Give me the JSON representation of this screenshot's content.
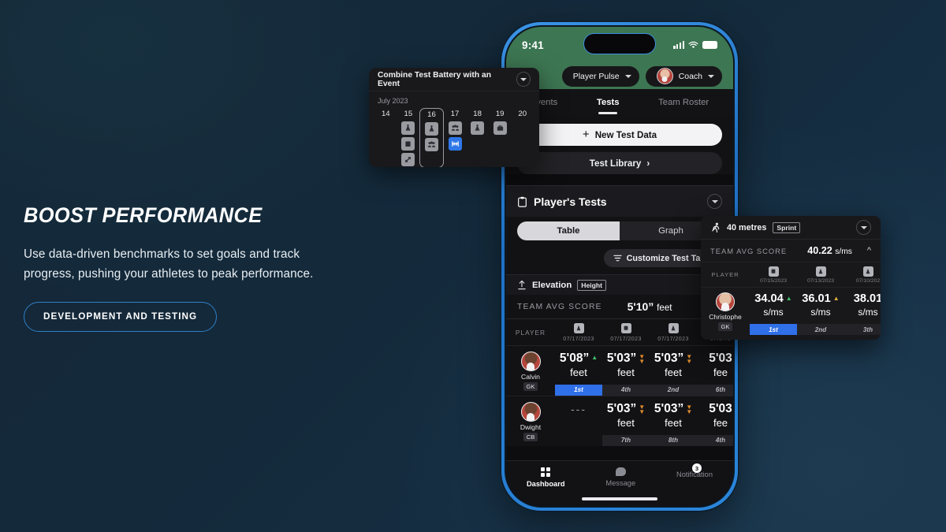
{
  "hero": {
    "title": "BOOST PERFORMANCE",
    "body": "Use data-driven benchmarks to set goals and track progress, pushing your athletes to peak performance.",
    "cta": "DEVELOPMENT AND TESTING",
    "accent": "#2f7fc4"
  },
  "phone": {
    "status": {
      "time": "9:41"
    },
    "header": {
      "mode_select": "Player Pulse",
      "role_select": "Coach"
    },
    "tabs": [
      {
        "label": "Events",
        "active": false
      },
      {
        "label": "Tests",
        "active": true
      },
      {
        "label": "Team Roster",
        "active": false
      }
    ],
    "actions": {
      "new_test": "New Test Data",
      "new_test_plus": "+",
      "test_library": "Test Library",
      "test_library_chevron": "›"
    },
    "players_tests": {
      "title": "Player's Tests",
      "segments": [
        {
          "label": "Table",
          "active": true
        },
        {
          "label": "Graph",
          "active": false
        }
      ],
      "customize": "Customize Test Table"
    },
    "metric": {
      "name": "Elevation",
      "tag": "Height",
      "avg_label": "TEAM AVG SCORE",
      "avg_value": "5'10”",
      "avg_unit": "feet",
      "collapse_caret": "⌃"
    },
    "table": {
      "player_col": "PLAYER",
      "columns": [
        {
          "date": "07/17/2023",
          "icon": "cone-icon"
        },
        {
          "date": "07/17/2023",
          "icon": "clipboard-icon"
        },
        {
          "date": "07/17/2023",
          "icon": "cone-icon"
        },
        {
          "date": "07/17/2",
          "icon": "cone-icon"
        }
      ],
      "rows": [
        {
          "name": "Calvin",
          "position": "GK",
          "cells": [
            {
              "value": "5'08”",
              "unit": "feet",
              "trend": "up",
              "rank": "1st",
              "first": true
            },
            {
              "value": "5'03”",
              "unit": "feet",
              "trend": "down",
              "rank": "4th",
              "first": false
            },
            {
              "value": "5'03”",
              "unit": "feet",
              "trend": "down",
              "rank": "2nd",
              "first": false
            },
            {
              "value": "5'03",
              "unit": "fee",
              "trend": "down",
              "rank": "6th",
              "first": false
            }
          ]
        },
        {
          "name": "Dwight",
          "position": "CB",
          "cells": [
            {
              "value": "---",
              "unit": "",
              "trend": "none",
              "rank": "",
              "first": false
            },
            {
              "value": "5'03”",
              "unit": "feet",
              "trend": "down",
              "rank": "7th",
              "first": false
            },
            {
              "value": "5'03”",
              "unit": "feet",
              "trend": "down",
              "rank": "8th",
              "first": false
            },
            {
              "value": "5'03",
              "unit": "fee",
              "trend": "down",
              "rank": "4th",
              "first": false
            }
          ]
        }
      ]
    },
    "bottom_nav": [
      {
        "label": "Dashboard",
        "icon": "grid-icon",
        "active": true,
        "badge": ""
      },
      {
        "label": "Message",
        "icon": "chat-bubble-icon",
        "active": false,
        "badge": ""
      },
      {
        "label": "Notification",
        "icon": "bell-icon",
        "active": false,
        "badge": "3"
      }
    ]
  },
  "calendar_popup": {
    "title": "Combine Test Battery with an Event",
    "month": "July 2023",
    "days": [
      {
        "num": "14",
        "selected": false,
        "events": []
      },
      {
        "num": "15",
        "selected": false,
        "events": [
          "cone-icon",
          "clipboard-icon",
          "expand-icon"
        ]
      },
      {
        "num": "16",
        "selected": true,
        "events": [
          "cone-icon",
          "group-icon"
        ]
      },
      {
        "num": "17",
        "selected": false,
        "events": [
          "group-icon",
          "match-icon"
        ]
      },
      {
        "num": "18",
        "selected": false,
        "events": [
          "cone-icon"
        ]
      },
      {
        "num": "19",
        "selected": false,
        "events": [
          "briefcase-icon"
        ]
      },
      {
        "num": "20",
        "selected": false,
        "events": []
      }
    ]
  },
  "sprint_popup": {
    "title": "40 metres",
    "tag": "Sprint",
    "avg_label": "TEAM AVG SCORE",
    "avg_value": "40.22",
    "avg_unit": "s/ms",
    "player_col": "PLAYER",
    "columns": [
      {
        "date": "07/15/2023",
        "icon": "clipboard-icon"
      },
      {
        "date": "07/13/2023",
        "icon": "cone-icon"
      },
      {
        "date": "07/10/202",
        "icon": "cone-icon"
      }
    ],
    "row": {
      "name": "Christophe",
      "position": "GK",
      "cells": [
        {
          "value": "34.04",
          "unit": "s/ms",
          "trend": "up",
          "rank": "1st",
          "first": true
        },
        {
          "value": "36.01",
          "unit": "s/ms",
          "trend": "up",
          "rank": "2nd",
          "first": false
        },
        {
          "value": "38.01",
          "unit": "s/ms",
          "trend": "none",
          "rank": "3th",
          "first": false
        }
      ]
    }
  }
}
